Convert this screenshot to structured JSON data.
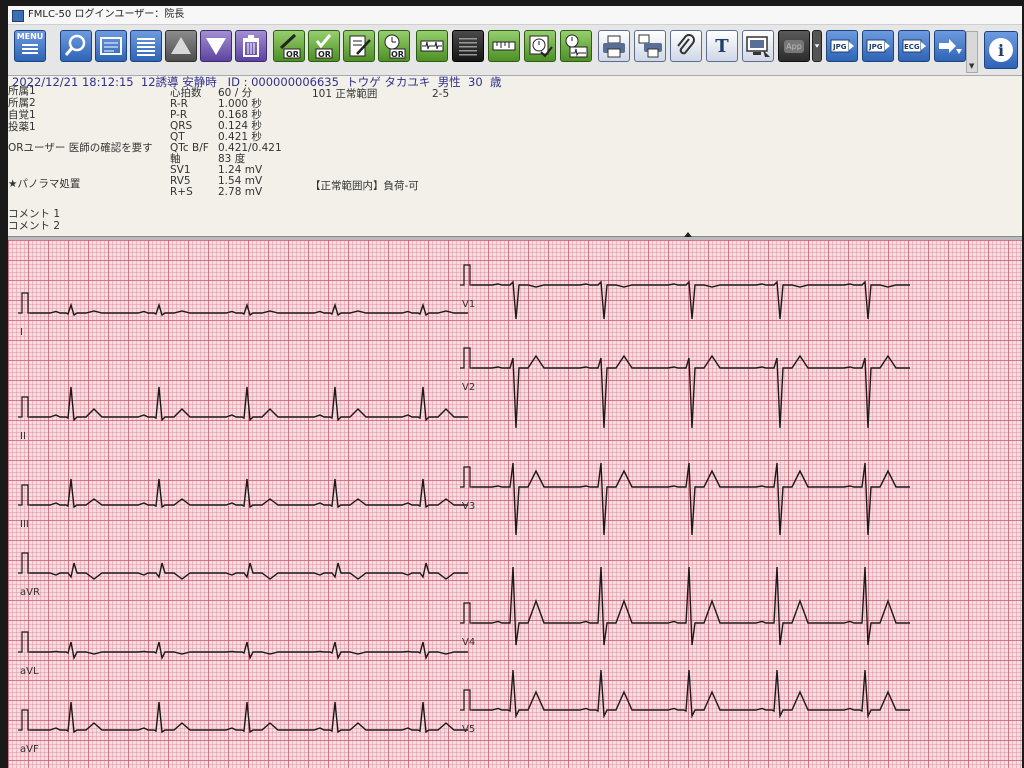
{
  "window": {
    "title": "FMLC-50  ログインユーザー：院長"
  },
  "toolbar": {
    "menu_label": "MENU",
    "app_label": "App",
    "or_label": "OR",
    "jpg_label": "JPG",
    "eco_label": "ECG",
    "buttons": [
      {
        "name": "menu-icon",
        "color": "blue"
      },
      {
        "name": "search-icon",
        "color": "blue"
      },
      {
        "name": "card-icon",
        "color": "blue"
      },
      {
        "name": "list-icon",
        "color": "blue"
      },
      {
        "name": "arrow-up-icon",
        "color": "gray"
      },
      {
        "name": "arrow-down-icon",
        "color": "purple"
      },
      {
        "name": "trash-icon",
        "color": "purple"
      },
      {
        "name": "sign-or-icon",
        "color": "green"
      },
      {
        "name": "check-or-icon",
        "color": "green"
      },
      {
        "name": "edit-document-icon",
        "color": "green"
      },
      {
        "name": "clock-or-icon",
        "color": "green"
      },
      {
        "name": "waveform-compare-icon",
        "color": "green"
      },
      {
        "name": "lines-icon",
        "color": "dark"
      },
      {
        "name": "ruler-icon",
        "color": "green"
      },
      {
        "name": "clock-check-icon",
        "color": "green"
      },
      {
        "name": "clock-wave-icon",
        "color": "green"
      },
      {
        "name": "print-icon",
        "color": "white"
      },
      {
        "name": "print-copy-icon",
        "color": "white"
      },
      {
        "name": "attach-icon",
        "color": "white"
      },
      {
        "name": "text-icon",
        "color": "white"
      },
      {
        "name": "monitor-icon",
        "color": "white"
      },
      {
        "name": "app-icon",
        "color": "app"
      },
      {
        "name": "export-jpg-icon",
        "color": "blue"
      },
      {
        "name": "export-jpg-2-icon",
        "color": "blue"
      },
      {
        "name": "export-ecg-icon",
        "color": "blue"
      },
      {
        "name": "transfer-icon",
        "color": "blue"
      }
    ]
  },
  "header": {
    "datetime": "2022/12/21 18:12:15",
    "lead_info": "12誘導  安静時",
    "id_label": "ID : 000000006635",
    "patient_name": "トウゲ タカユキ",
    "sex": "男性",
    "age": "30",
    "age_unit": "歳"
  },
  "info": {
    "fields_left": [
      "所属1",
      "所属2",
      "自覚1",
      "投薬1"
    ],
    "or_user": "ORユーザー  医師の確認を要す",
    "panorama": "★パノラマ処置",
    "comment1": "コメント 1",
    "comment2": "コメント 2",
    "measurements": [
      {
        "label": "心拍数",
        "value": "60 / 分"
      },
      {
        "label": "R-R",
        "value": "1.000 秒"
      },
      {
        "label": "P-R",
        "value": "0.168 秒"
      },
      {
        "label": "QRS",
        "value": "0.124 秒"
      },
      {
        "label": "QT",
        "value": "0.421 秒"
      },
      {
        "label": "QTc B/F",
        "value": "0.421/0.421"
      },
      {
        "label": "軸",
        "value": "83 度"
      },
      {
        "label": "SV1",
        "value": "1.24 mV"
      },
      {
        "label": "RV5",
        "value": "1.54 mV"
      },
      {
        "label": "R+S",
        "value": "2.78 mV"
      }
    ],
    "diagnosis_code": "101 正常範囲",
    "diagnosis_extra": "2-5",
    "summary": "【正常範囲内】負荷-可"
  },
  "leads": [
    "I",
    "II",
    "III",
    "aVR",
    "aVL",
    "aVF",
    "V1",
    "V2",
    "V3",
    "V4",
    "V5"
  ]
}
